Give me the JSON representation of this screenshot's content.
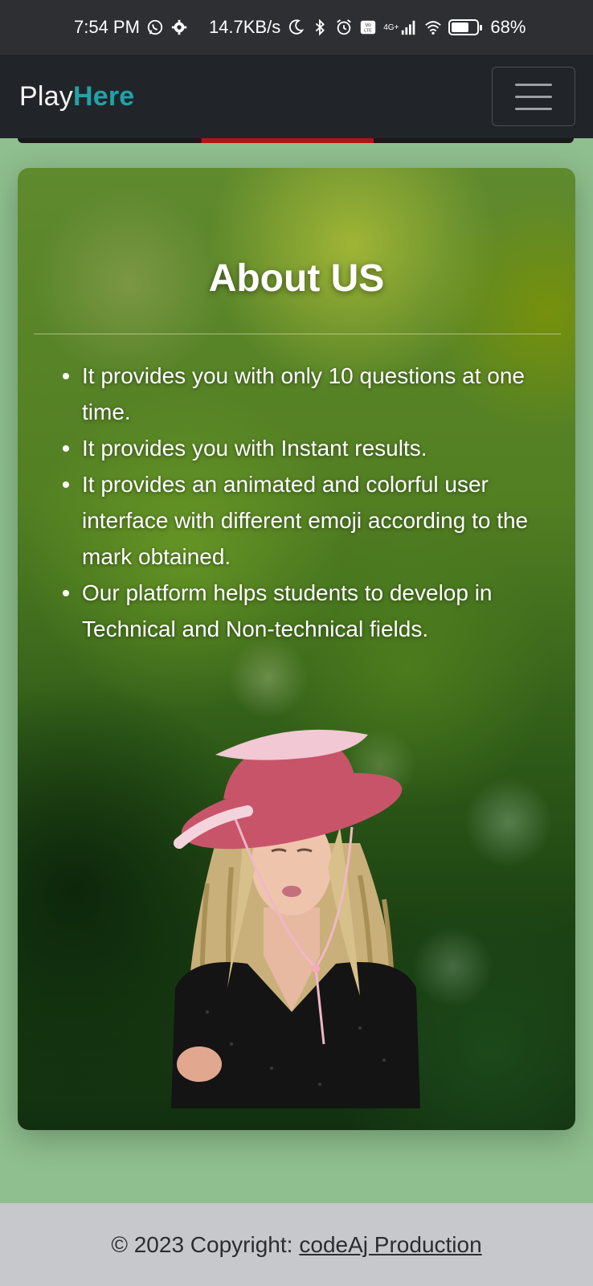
{
  "status_bar": {
    "time": "7:54 PM",
    "speed": "14.7KB/s",
    "network": "4G+",
    "battery": "68%",
    "battery_level": 0.68,
    "icons": [
      "whatsapp-icon",
      "settings-icon",
      "moon-icon",
      "bluetooth-icon",
      "alarm-icon",
      "volte-icon",
      "signal-icon",
      "wifi-icon",
      "battery-icon"
    ]
  },
  "navbar": {
    "brand_main": "Play",
    "brand_accent": "Here",
    "brand_accent_color": "#20a3a8"
  },
  "about": {
    "title": "About US",
    "items": [
      "It provides you with only 10 questions at one time.",
      "It provides you with Instant results.",
      "It provides an animated and colorful user interface with different emoji according to the mark obtained.",
      "Our platform helps students to develop in Technical and Non-technical fields."
    ]
  },
  "footer": {
    "text": "© 2023 Copyright:",
    "link": "codeAj Production"
  }
}
